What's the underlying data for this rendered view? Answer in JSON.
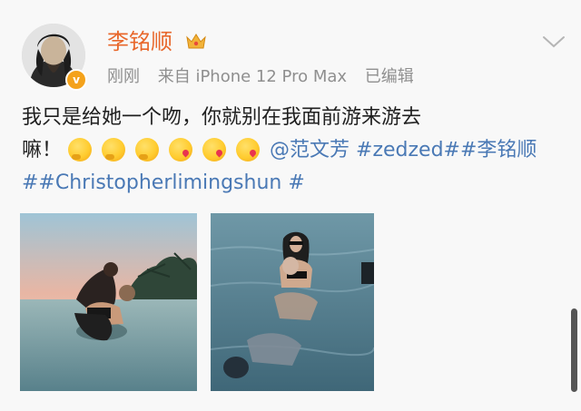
{
  "post": {
    "author_name": "李铭顺",
    "time": "刚刚",
    "source": "来自 iPhone 12 Pro Max",
    "edited": "已编辑",
    "text_line1": "我只是给她一个吻，你就别在我面前游来游去",
    "text_line2_prefix": "嘛！",
    "mention": "@范文芳",
    "topic1": "#zedzed#",
    "topic2": "#李铭顺",
    "topic3": "##Christopherlimingshun #",
    "emojis": [
      "thinking-face",
      "thinking-face",
      "thinking-face",
      "kissing-heart-face",
      "kissing-heart-face",
      "kissing-heart-face"
    ]
  },
  "icons": {
    "verified": "verified-badge-icon",
    "crown": "crown-icon",
    "more": "chevron-down-icon"
  },
  "colors": {
    "name": "#e8672b",
    "link": "#4a79b5",
    "meta": "#8f8f8f",
    "badge": "#f4a21b"
  }
}
